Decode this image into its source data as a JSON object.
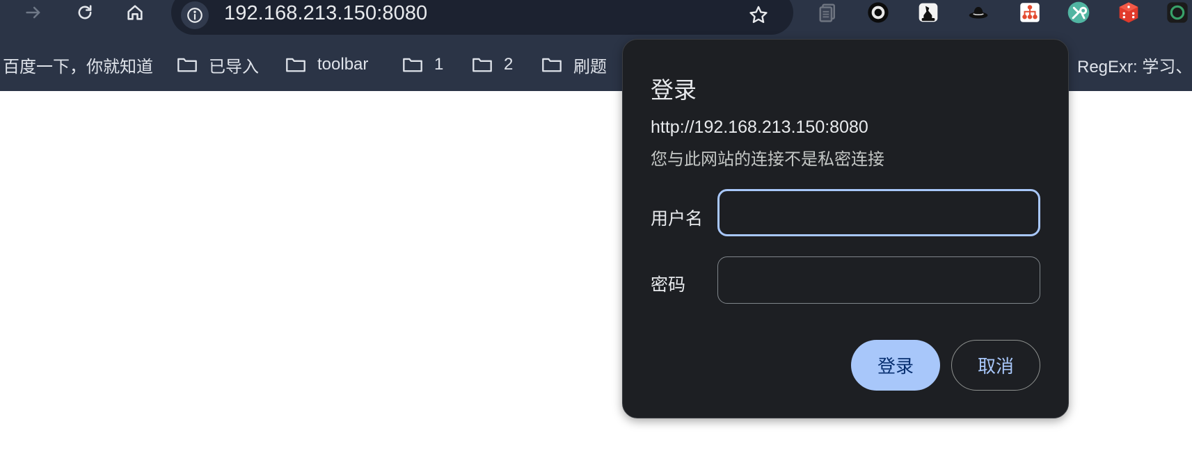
{
  "toolbar": {
    "forward_icon": "arrow-right-icon",
    "reload_icon": "reload-icon",
    "home_icon": "home-icon",
    "site_info_icon": "info-icon",
    "url": "192.168.213.150:8080",
    "bookmark_star_icon": "star-icon",
    "extensions": [
      "layers-icon",
      "ring-icon",
      "chess-icon",
      "hat-icon",
      "sitemap-icon",
      "tools-icon",
      "dice-icon",
      "circle-icon"
    ]
  },
  "bookmarks": [
    {
      "label": "百度一下，你就知道",
      "icon": null
    },
    {
      "label": "已导入",
      "icon": "folder-icon"
    },
    {
      "label": "toolbar",
      "icon": "folder-icon"
    },
    {
      "label": "1",
      "icon": "folder-icon"
    },
    {
      "label": "2",
      "icon": "folder-icon"
    },
    {
      "label": "刷题",
      "icon": "folder-icon"
    },
    {
      "label": "RegExr: 学习、",
      "icon": "regex-icon"
    }
  ],
  "dialog": {
    "title": "登录",
    "origin": "http://192.168.213.150:8080",
    "warning": "您与此网站的连接不是私密连接",
    "username_label": "用户名",
    "username_value": "",
    "password_label": "密码",
    "password_value": "",
    "login_button": "登录",
    "cancel_button": "取消"
  },
  "colors": {
    "toolbar_bg": "#2b3446",
    "omnibox_bg": "#1c2230",
    "dialog_bg": "#1d1f23",
    "accent": "#a8c7fa",
    "primary_button_text": "#062e6f"
  }
}
